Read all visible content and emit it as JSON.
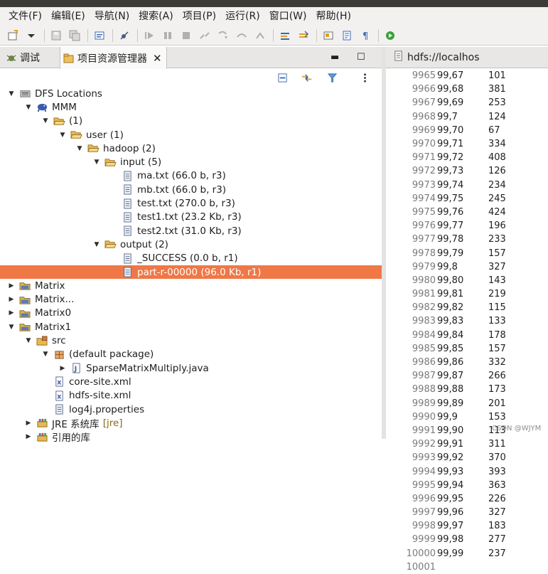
{
  "menubar": [
    "文件(F)",
    "编辑(E)",
    "导航(N)",
    "搜索(A)",
    "项目(P)",
    "运行(R)",
    "窗口(W)",
    "帮助(H)"
  ],
  "tabs": {
    "debug": "调试",
    "explorer": "项目资源管理器",
    "close": "✕",
    "minimize": "▬",
    "maximize": "☐"
  },
  "editor": {
    "tab_title": "hdfs://localhos",
    "lines": [
      {
        "n": "9965",
        "k": "99,67",
        "v": "101"
      },
      {
        "n": "9966",
        "k": "99,68",
        "v": "381"
      },
      {
        "n": "9967",
        "k": "99,69",
        "v": "253"
      },
      {
        "n": "9968",
        "k": "99,7",
        "v": "124"
      },
      {
        "n": "9969",
        "k": "99,70",
        "v": "67"
      },
      {
        "n": "9970",
        "k": "99,71",
        "v": "334"
      },
      {
        "n": "9971",
        "k": "99,72",
        "v": "408"
      },
      {
        "n": "9972",
        "k": "99,73",
        "v": "126"
      },
      {
        "n": "9973",
        "k": "99,74",
        "v": "234"
      },
      {
        "n": "9974",
        "k": "99,75",
        "v": "245"
      },
      {
        "n": "9975",
        "k": "99,76",
        "v": "424"
      },
      {
        "n": "9976",
        "k": "99,77",
        "v": "196"
      },
      {
        "n": "9977",
        "k": "99,78",
        "v": "233"
      },
      {
        "n": "9978",
        "k": "99,79",
        "v": "157"
      },
      {
        "n": "9979",
        "k": "99,8",
        "v": "327"
      },
      {
        "n": "9980",
        "k": "99,80",
        "v": "143"
      },
      {
        "n": "9981",
        "k": "99,81",
        "v": "219"
      },
      {
        "n": "9982",
        "k": "99,82",
        "v": "115"
      },
      {
        "n": "9983",
        "k": "99,83",
        "v": "133"
      },
      {
        "n": "9984",
        "k": "99,84",
        "v": "178"
      },
      {
        "n": "9985",
        "k": "99,85",
        "v": "157"
      },
      {
        "n": "9986",
        "k": "99,86",
        "v": "332"
      },
      {
        "n": "9987",
        "k": "99,87",
        "v": "266"
      },
      {
        "n": "9988",
        "k": "99,88",
        "v": "173"
      },
      {
        "n": "9989",
        "k": "99,89",
        "v": "201"
      },
      {
        "n": "9990",
        "k": "99,9",
        "v": "153"
      },
      {
        "n": "9991",
        "k": "99,90",
        "v": "113"
      },
      {
        "n": "9992",
        "k": "99,91",
        "v": "311"
      },
      {
        "n": "9993",
        "k": "99,92",
        "v": "370"
      },
      {
        "n": "9994",
        "k": "99,93",
        "v": "393"
      },
      {
        "n": "9995",
        "k": "99,94",
        "v": "363"
      },
      {
        "n": "9996",
        "k": "99,95",
        "v": "226"
      },
      {
        "n": "9997",
        "k": "99,96",
        "v": "327"
      },
      {
        "n": "9998",
        "k": "99,97",
        "v": "183"
      },
      {
        "n": "9999",
        "k": "99,98",
        "v": "277"
      },
      {
        "n": "10000",
        "k": "99,99",
        "v": "237"
      },
      {
        "n": "10001",
        "k": "",
        "v": ""
      }
    ]
  },
  "tree": [
    {
      "label": "DFS Locations",
      "depth": 0,
      "arrow": "open",
      "icon": "dfs-locations-icon"
    },
    {
      "label": "MMM",
      "depth": 1,
      "arrow": "open",
      "icon": "hadoop-elephant-icon"
    },
    {
      "label": "(1)",
      "depth": 2,
      "arrow": "open",
      "icon": "folder-open-icon"
    },
    {
      "label": "user (1)",
      "depth": 3,
      "arrow": "open",
      "icon": "folder-open-icon"
    },
    {
      "label": "hadoop (2)",
      "depth": 4,
      "arrow": "open",
      "icon": "folder-open-icon"
    },
    {
      "label": "input (5)",
      "depth": 5,
      "arrow": "open",
      "icon": "folder-open-icon"
    },
    {
      "label": "ma.txt (66.0 b, r3)",
      "depth": 6,
      "arrow": "none",
      "icon": "file-icon"
    },
    {
      "label": "mb.txt (66.0 b, r3)",
      "depth": 6,
      "arrow": "none",
      "icon": "file-icon"
    },
    {
      "label": "test.txt (270.0 b, r3)",
      "depth": 6,
      "arrow": "none",
      "icon": "file-icon"
    },
    {
      "label": "test1.txt (23.2 Kb, r3)",
      "depth": 6,
      "arrow": "none",
      "icon": "file-icon"
    },
    {
      "label": "test2.txt (31.0 Kb, r3)",
      "depth": 6,
      "arrow": "none",
      "icon": "file-icon"
    },
    {
      "label": "output (2)",
      "depth": 5,
      "arrow": "open",
      "icon": "folder-open-icon"
    },
    {
      "label": "_SUCCESS (0.0 b, r1)",
      "depth": 6,
      "arrow": "none",
      "icon": "file-icon"
    },
    {
      "label": "part-r-00000 (96.0 Kb, r1)",
      "depth": 6,
      "arrow": "none",
      "icon": "file-icon",
      "selected": true
    },
    {
      "label": "Matrix",
      "depth": 0,
      "arrow": "closed",
      "icon": "project-folder-icon"
    },
    {
      "label": "Matrix...",
      "depth": 0,
      "arrow": "closed",
      "icon": "project-folder-icon"
    },
    {
      "label": "Matrix0",
      "depth": 0,
      "arrow": "closed",
      "icon": "project-folder-icon"
    },
    {
      "label": "Matrix1",
      "depth": 0,
      "arrow": "open",
      "icon": "project-folder-icon"
    },
    {
      "label": "src",
      "depth": 1,
      "arrow": "open",
      "icon": "source-folder-icon"
    },
    {
      "label": "(default package)",
      "depth": 2,
      "arrow": "open",
      "icon": "package-icon"
    },
    {
      "label": "SparseMatrixMultiply.java",
      "depth": 3,
      "arrow": "closed",
      "icon": "java-file-icon"
    },
    {
      "label": "core-site.xml",
      "depth": 2,
      "arrow": "none",
      "icon": "xml-file-icon"
    },
    {
      "label": "hdfs-site.xml",
      "depth": 2,
      "arrow": "none",
      "icon": "xml-file-icon"
    },
    {
      "label": "log4j.properties",
      "depth": 2,
      "arrow": "none",
      "icon": "file-icon"
    },
    {
      "label": "JRE 系统库",
      "suffix": "[jre]",
      "depth": 1,
      "arrow": "closed",
      "icon": "library-icon"
    },
    {
      "label": "引用的库",
      "depth": 1,
      "arrow": "closed",
      "icon": "library-icon"
    }
  ],
  "watermark": "CSDN @WJYM"
}
